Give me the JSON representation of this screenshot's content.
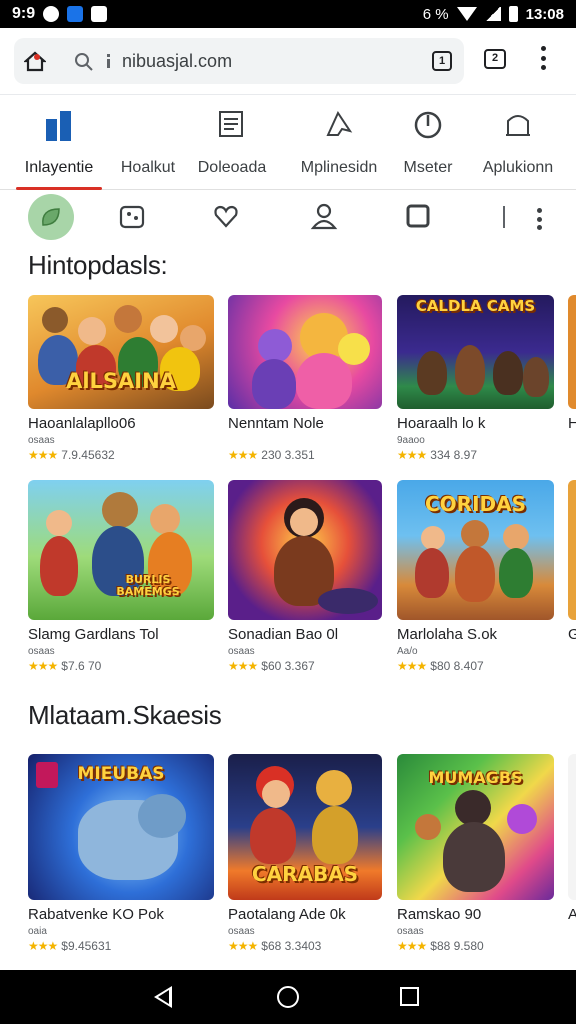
{
  "status_bar": {
    "time": "9:9",
    "right_text": "6 %",
    "clock": "13:08"
  },
  "browser": {
    "url": "nibuasjal.com",
    "tab_count_inner": "1",
    "tab_count": "2"
  },
  "categories": [
    {
      "label": "Inlayentie",
      "icon": "bar-chart-icon"
    },
    {
      "label": "Hoalkut",
      "icon": "none"
    },
    {
      "label": "Doleoada",
      "icon": "document-icon"
    },
    {
      "label": "Mplinesidn",
      "icon": "airplane-icon"
    },
    {
      "label": "Mseter",
      "icon": "power-icon"
    },
    {
      "label": "Aplukionn",
      "icon": "profile-icon"
    }
  ],
  "filters": [
    "leaf-icon",
    "puzzle-icon",
    "heart-icon",
    "person-icon",
    "square-icon",
    "more-icon"
  ],
  "sections": [
    {
      "title": "Hintopdasls:"
    },
    {
      "title": "Mlataam.Skaesis"
    }
  ],
  "row1": [
    {
      "title": "Haoanlalapllo06",
      "sub": "osaas",
      "rating": "7.9.45632",
      "logo": "AlLSAINA"
    },
    {
      "title": "Nenntam Nole",
      "sub": "",
      "rating": "230 3.351",
      "logo": ""
    },
    {
      "title": "Hoaraalh lo k",
      "sub": "9aaoo",
      "rating": "334 8.97",
      "logo": "CALDLA CAMS"
    },
    {
      "title": "H",
      "sub": "",
      "rating": "",
      "logo": ""
    }
  ],
  "row2": [
    {
      "title": "Slamg Gardlans Tol",
      "sub": "osaas",
      "rating": "$7.6 70",
      "logo": "BURLIS BAMEMGS"
    },
    {
      "title": "Sonadian Bao 0l",
      "sub": "osaas",
      "rating": "$60 3.367",
      "logo": ""
    },
    {
      "title": "Marlolaha S.ok",
      "sub": "Aa/o",
      "rating": "$80 8.407",
      "logo": "CORIDAS"
    },
    {
      "title": "G",
      "sub": "",
      "rating": "",
      "logo": ""
    }
  ],
  "row3": [
    {
      "title": "Rabatvenke KO Pok",
      "sub": "oaia",
      "rating": "$9.45631",
      "logo": "MIEUBAS"
    },
    {
      "title": "Paotalang Ade 0k",
      "sub": "osaas",
      "rating": "$68 3.3403",
      "logo": "CARABAS"
    },
    {
      "title": "Ramskao 90",
      "sub": "osaas",
      "rating": "$88 9.580",
      "logo": "MUMAGBS"
    },
    {
      "title": "A",
      "sub": "",
      "rating": "",
      "logo": ""
    }
  ],
  "stars": "★★★",
  "colors": {
    "accent": "#d93025",
    "star": "#f4b400",
    "active_filter": "#a8d5a8"
  }
}
